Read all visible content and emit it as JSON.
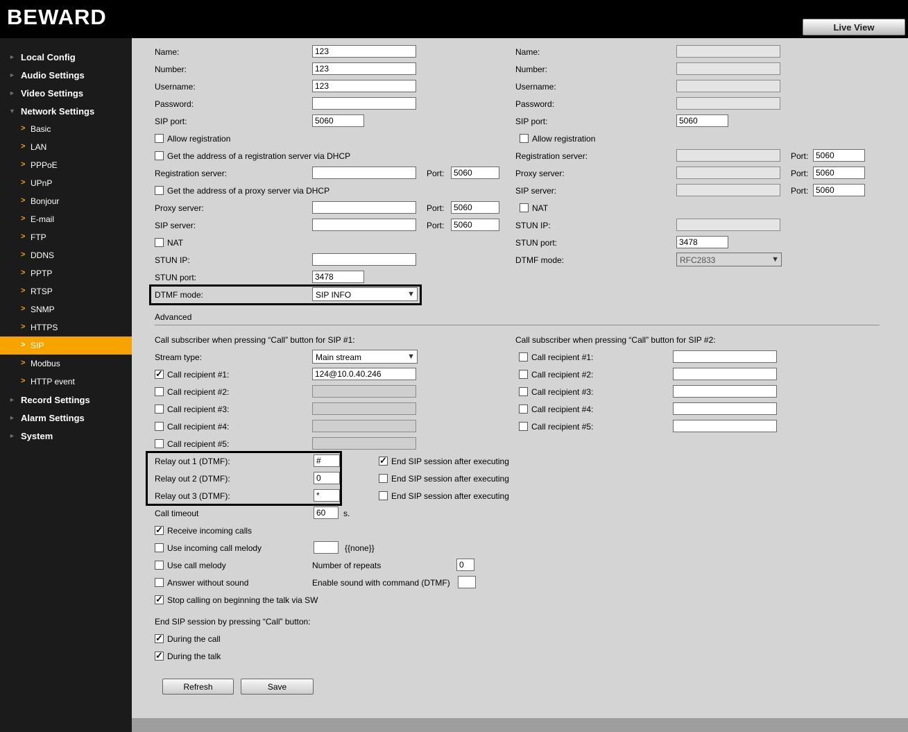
{
  "header": {
    "logo": "BEWARD",
    "live_view_label": "Live View"
  },
  "sidebar": {
    "items": [
      {
        "label": "Local Config",
        "level": 1,
        "expanded": false
      },
      {
        "label": "Audio Settings",
        "level": 1,
        "expanded": false
      },
      {
        "label": "Video Settings",
        "level": 1,
        "expanded": false
      },
      {
        "label": "Network Settings",
        "level": 1,
        "expanded": true
      },
      {
        "label": "Basic",
        "level": 2
      },
      {
        "label": "LAN",
        "level": 2
      },
      {
        "label": "PPPoE",
        "level": 2
      },
      {
        "label": "UPnP",
        "level": 2
      },
      {
        "label": "Bonjour",
        "level": 2
      },
      {
        "label": "E-mail",
        "level": 2
      },
      {
        "label": "FTP",
        "level": 2
      },
      {
        "label": "DDNS",
        "level": 2
      },
      {
        "label": "PPTP",
        "level": 2
      },
      {
        "label": "RTSP",
        "level": 2
      },
      {
        "label": "SNMP",
        "level": 2
      },
      {
        "label": "HTTPS",
        "level": 2
      },
      {
        "label": "SIP",
        "level": 2,
        "active": true
      },
      {
        "label": "Modbus",
        "level": 2
      },
      {
        "label": "HTTP event",
        "level": 2
      },
      {
        "label": "Record Settings",
        "level": 1,
        "expanded": false
      },
      {
        "label": "Alarm Settings",
        "level": 1,
        "expanded": false
      },
      {
        "label": "System",
        "level": 1,
        "expanded": false
      }
    ]
  },
  "labels": {
    "name": "Name:",
    "number": "Number:",
    "username": "Username:",
    "password": "Password:",
    "sip_port": "SIP port:",
    "allow_registration": "Allow registration",
    "reg_dhcp": "Get the address of a registration server via DHCP",
    "registration_server": "Registration server:",
    "port": "Port:",
    "proxy_dhcp": "Get the address of a proxy server via DHCP",
    "proxy_server": "Proxy server:",
    "sip_server": "SIP server:",
    "nat": "NAT",
    "stun_ip": "STUN IP:",
    "stun_port": "STUN port:",
    "dtmf_mode": "DTMF mode:"
  },
  "sip1": {
    "name": "123",
    "number": "123",
    "username": "123",
    "password": "",
    "sip_port": "5060",
    "allow_registration": false,
    "reg_dhcp": false,
    "registration_server": "",
    "registration_port": "5060",
    "proxy_dhcp": false,
    "proxy_server": "",
    "proxy_port": "5060",
    "sip_server": "",
    "sip_server_port": "5060",
    "nat": false,
    "stun_ip": "",
    "stun_port": "3478",
    "dtmf_mode": "SIP INFO"
  },
  "sip2": {
    "name": "",
    "number": "",
    "username": "",
    "password": "",
    "sip_port": "5060",
    "allow_registration": false,
    "registration_server": "",
    "registration_port": "5060",
    "proxy_server": "",
    "proxy_port": "5060",
    "sip_server": "",
    "sip_server_port": "5060",
    "nat": false,
    "stun_ip": "",
    "stun_port": "3478",
    "dtmf_mode": "RFC2833"
  },
  "advanced": {
    "section_title": "Advanced",
    "sip1_title": "Call subscriber when pressing “Call” button for SIP #1:",
    "sip2_title": "Call subscriber when pressing “Call” button for SIP #2:",
    "stream_type_label": "Stream type:",
    "stream_type_value": "Main stream",
    "recipients_sip1": [
      {
        "label": "Call recipient #1:",
        "checked": true,
        "value": "124@10.0.40.246"
      },
      {
        "label": "Call recipient #2:",
        "checked": false,
        "value": ""
      },
      {
        "label": "Call recipient #3:",
        "checked": false,
        "value": ""
      },
      {
        "label": "Call recipient #4:",
        "checked": false,
        "value": ""
      },
      {
        "label": "Call recipient #5:",
        "checked": false,
        "value": ""
      }
    ],
    "recipients_sip2": [
      {
        "label": "Call recipient #1:",
        "checked": false,
        "value": ""
      },
      {
        "label": "Call recipient #2:",
        "checked": false,
        "value": ""
      },
      {
        "label": "Call recipient #3:",
        "checked": false,
        "value": ""
      },
      {
        "label": "Call recipient #4:",
        "checked": false,
        "value": ""
      },
      {
        "label": "Call recipient #5:",
        "checked": false,
        "value": ""
      }
    ],
    "relays": [
      {
        "label": "Relay out 1 (DTMF):",
        "value": "#",
        "end_checked": true
      },
      {
        "label": "Relay out 2 (DTMF):",
        "value": "0",
        "end_checked": false
      },
      {
        "label": "Relay out 3 (DTMF):",
        "value": "*",
        "end_checked": false
      }
    ],
    "end_sip_label": "End SIP session after executing",
    "call_timeout_label": "Call timeout",
    "call_timeout_value": "60",
    "call_timeout_unit": "s.",
    "receive_incoming_label": "Receive incoming calls",
    "receive_incoming_checked": true,
    "incoming_melody_label": "Use incoming call melody",
    "incoming_melody_checked": false,
    "incoming_melody_value": "",
    "incoming_melody_note": "{{none}}",
    "call_melody_label": "Use call melody",
    "call_melody_checked": false,
    "repeats_label": "Number of repeats",
    "repeats_value": "0",
    "answer_without_sound_label": "Answer without sound",
    "answer_without_sound_checked": false,
    "enable_sound_label": "Enable sound with command (DTMF)",
    "enable_sound_value": "",
    "stop_calling_label": "Stop calling on beginning the talk via SW",
    "stop_calling_checked": true,
    "end_session_title": "End SIP session by pressing “Call” button:",
    "during_call_label": "During the call",
    "during_call_checked": true,
    "during_talk_label": "During the talk",
    "during_talk_checked": true
  },
  "buttons": {
    "refresh": "Refresh",
    "save": "Save"
  }
}
